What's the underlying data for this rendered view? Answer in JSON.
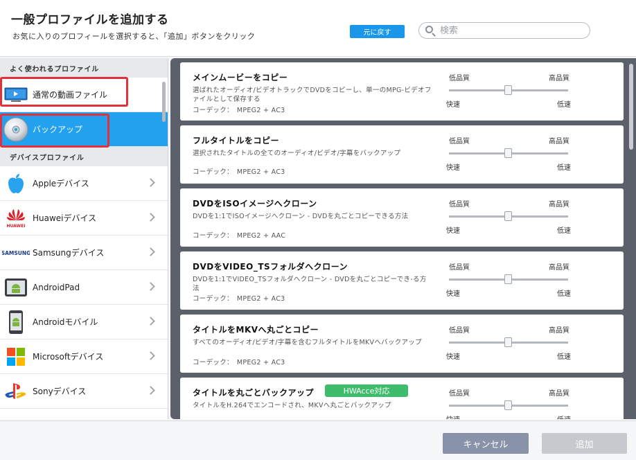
{
  "header": {
    "title": "一般プロファイルを追加する",
    "subtitle": "お気に入りのプロフィールを選択すると、「追加」ボタンをクリック",
    "back_label": "元に戻す",
    "search_placeholder": "検索"
  },
  "sidebar": {
    "section_common": "よく使われるプロファイル",
    "common_items": [
      {
        "label": "通常の動画ファイル",
        "icon": "video-file-icon",
        "selected": false
      },
      {
        "label": "バックアップ",
        "icon": "disc-icon",
        "selected": true
      }
    ],
    "section_devices": "デバイスプロファイル",
    "device_items": [
      {
        "label": "Appleデバイス",
        "icon": "apple-icon"
      },
      {
        "label": "Huaweiデバイス",
        "icon": "huawei-icon",
        "brand_text": "HUAWEI"
      },
      {
        "label": "Samsungデバイス",
        "icon": "samsung-icon",
        "brand_text": "SAMSUNG"
      },
      {
        "label": "AndroidPad",
        "icon": "android-pad-icon"
      },
      {
        "label": "Androidモバイル",
        "icon": "android-phone-icon"
      },
      {
        "label": "Microsoftデバイス",
        "icon": "microsoft-icon"
      },
      {
        "label": "Sonyデバイス",
        "icon": "playstation-icon"
      }
    ]
  },
  "quality": {
    "low": "低品質",
    "high": "高品質",
    "fast": "快速",
    "slow": "低速"
  },
  "profiles": [
    {
      "title": "メインムービーをコピー",
      "description": "選ばれたオーディオ/ビデオトラックでDVDをコピーし、単一のMPG-ビデオファイルとして保存する",
      "codec": "コーデック：　MPEG2 + AC3",
      "badge": ""
    },
    {
      "title": "フルタイトルをコピー",
      "description": "選択されたタイトルの全てのオーディオ/ビデオ/字幕をバックアップ",
      "codec": "コーデック：　MPEG2 + AC3",
      "badge": ""
    },
    {
      "title": "DVDをISOイメージへクローン",
      "description": "DVDを1:1でISOイメージへクローン - DVDを丸ごとコピーできる方法",
      "codec": "コーデック：　MPEG2 + AAC",
      "badge": ""
    },
    {
      "title": "DVDをVIDEO_TSフォルダへクローン",
      "description": "DVDを1:1でVIDEO_TSフォルダへクローン - DVDを丸ごとコピーでき-る方法",
      "codec": "コーデック：　MPEG2 + AC3",
      "badge": ""
    },
    {
      "title": "タイトルをMKVへ丸ごとコピー",
      "description": "すべてのオーディオ/ビデオ/字幕を含むフルタイトルをMKVへバックアップ",
      "codec": "コーデック：　MPEG2 + AC3",
      "badge": ""
    },
    {
      "title": "タイトルを丸ごとバックアップ",
      "description": "タイトルをH.264でエンコードされ、MKVへ丸ごとバックアップ",
      "codec": "",
      "badge": "HWAcce対応"
    }
  ],
  "footer": {
    "cancel_label": "キャンセル",
    "add_label": "追加"
  },
  "colors": {
    "accent": "#23a0ee",
    "highlight_box": "#e0313c",
    "badge": "#3dbd6b"
  }
}
